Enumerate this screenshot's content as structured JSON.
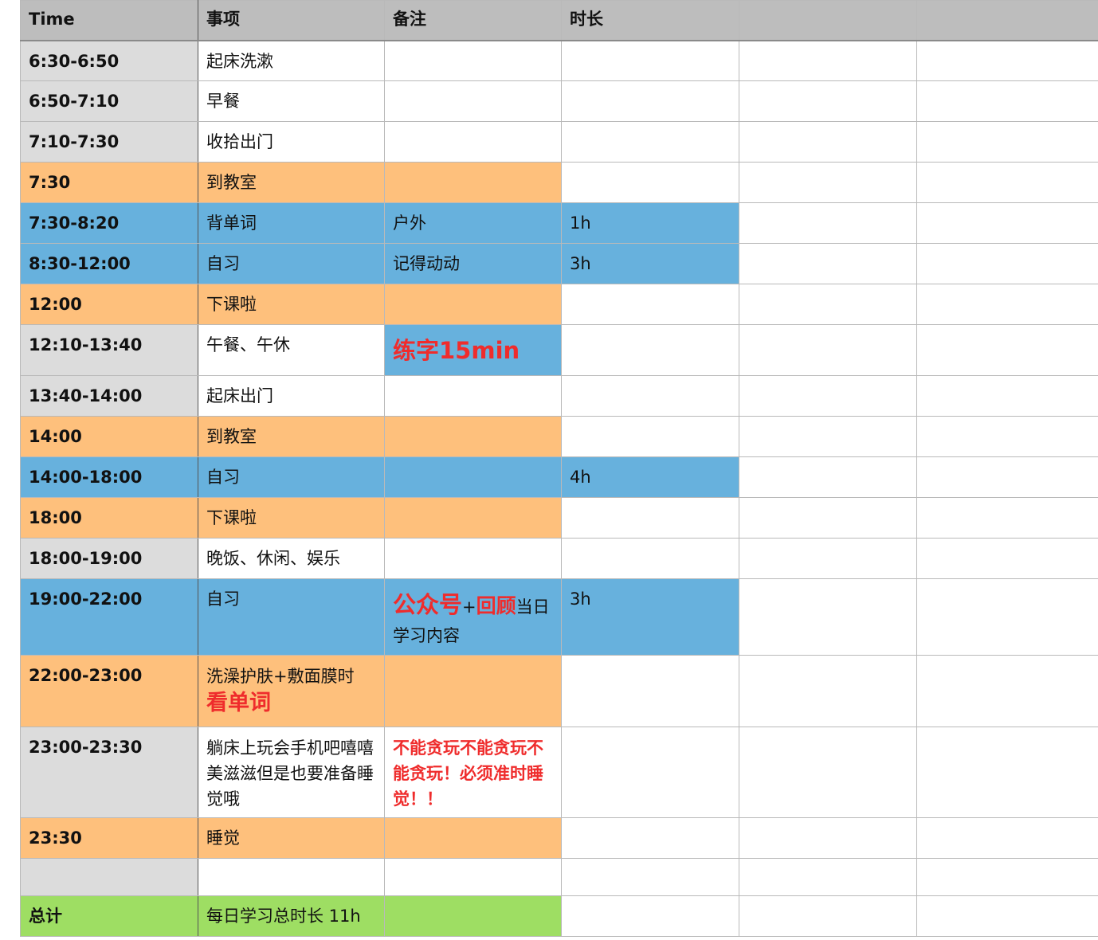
{
  "header": [
    "Time",
    "事项",
    "备注",
    "时长",
    "",
    ""
  ],
  "rows": [
    {
      "time": "6:30-6:50",
      "item": "起床洗漱"
    },
    {
      "time": "6:50-7:10",
      "item": "早餐"
    },
    {
      "time": "7:10-7:30",
      "item": "收拾出门"
    },
    {
      "time": "7:30",
      "item": "到教室"
    },
    {
      "time": "7:30-8:20",
      "item": "背单词",
      "note": "户外",
      "dur": "1h"
    },
    {
      "time": "8:30-12:00",
      "item": "自习",
      "note": "记得动动",
      "dur": "3h"
    },
    {
      "time": "12:00",
      "item": "下课啦"
    },
    {
      "time": "12:10-13:40",
      "item": "午餐、午休",
      "note": "练字15min"
    },
    {
      "time": "13:40-14:00",
      "item": "起床出门"
    },
    {
      "time": "14:00",
      "item": "到教室"
    },
    {
      "time": "14:00-18:00",
      "item": "自习",
      "dur": "4h"
    },
    {
      "time": "18:00",
      "item": "下课啦"
    },
    {
      "time": "18:00-19:00",
      "item": "晚饭、休闲、娱乐"
    },
    {
      "time": "19:00-22:00",
      "item": "自习",
      "note_a": "公众号",
      "note_b": "+",
      "note_c": "回顾",
      "note_d": "当日学习内容",
      "dur": "3h"
    },
    {
      "time": "22:00-23:00",
      "item": "洗澡护肤+敷面膜时",
      "item_b": "看单词"
    },
    {
      "time": "23:00-23:30",
      "item": "躺床上玩会手机吧嘻嘻美滋滋但是也要准备睡觉哦",
      "note": "不能贪玩不能贪玩不能贪玩！必须准时睡觉！！"
    },
    {
      "time": "23:30",
      "item": "睡觉"
    },
    {
      "time": "",
      "item": ""
    },
    {
      "time": "总计",
      "item": "每日学习总时长 11h"
    }
  ],
  "colors": {
    "header": "#bdbdbd",
    "time_col": "#dcdcdc",
    "orange": "#fec07c",
    "blue": "#67b1dd",
    "green": "#9ede63",
    "red_text": "#ef2c2c"
  }
}
